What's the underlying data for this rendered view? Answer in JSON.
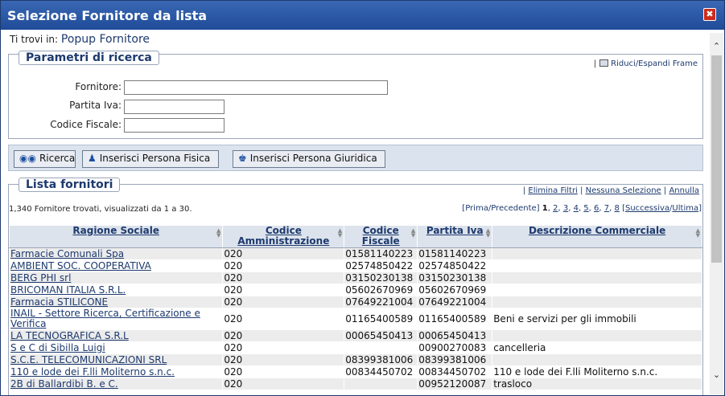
{
  "window": {
    "title": "Selezione Fornitore da lista",
    "close_label": "✖"
  },
  "breadcrumb": {
    "label": "Ti trovi in:",
    "value": "Popup Fornitore"
  },
  "search_panel": {
    "legend": "Parametri di ricerca",
    "frame_toggle": "Riduci/Espandi Frame",
    "fields": {
      "fornitore_label": "Fornitore:",
      "fornitore_value": "",
      "piva_label": "Partita Iva:",
      "piva_value": "",
      "cf_label": "Codice Fiscale:",
      "cf_value": ""
    }
  },
  "toolbar": {
    "search": "Ricerca",
    "add_physical": "Inserisci Persona Fisica",
    "add_legal": "Inserisci Persona Giuridica"
  },
  "list": {
    "legend": "Lista fornitori",
    "links": {
      "remove_filters": "Elimina Filtri",
      "no_selection": "Nessuna Selezione",
      "cancel": "Annulla"
    },
    "count_text": "1,340 Fornitore trovati, visualizzati da 1 a 30.",
    "pager": {
      "prefix": "[",
      "first": "Prima",
      "prev": "Precedente",
      "middle": "]",
      "current": "1",
      "pages": [
        "2",
        "3",
        "4",
        "5",
        "6",
        "7",
        "8"
      ],
      "next_prefix": "[",
      "next": "Successiva",
      "last": "Ultima",
      "suffix": "]"
    },
    "columns": {
      "name": "Ragione Sociale",
      "admin_code": "Codice Amministrazione",
      "fiscal_code": "Codice Fiscale",
      "vat": "Partita Iva",
      "description": "Descrizione Commerciale"
    },
    "rows": [
      {
        "name": "Farmacie Comunali Spa",
        "admin": "020",
        "cf": "01581140223",
        "vat": "01581140223",
        "desc": ""
      },
      {
        "name": "AMBIENT SOC. COOPERATIVA",
        "admin": "020",
        "cf": "02574850422",
        "vat": "02574850422",
        "desc": ""
      },
      {
        "name": "BERG PHI srl",
        "admin": "020",
        "cf": "03150230138",
        "vat": "03150230138",
        "desc": ""
      },
      {
        "name": "BRICOMAN ITALIA S.R.L.",
        "admin": "020",
        "cf": "05602670969",
        "vat": "05602670969",
        "desc": ""
      },
      {
        "name": "Farmacia STILICONE",
        "admin": "020",
        "cf": "07649221004",
        "vat": "07649221004",
        "desc": ""
      },
      {
        "name": "INAIL - Settore Ricerca, Certificazione e Verifica",
        "admin": "020",
        "cf": "01165400589",
        "vat": "01165400589",
        "desc": "Beni e servizi per gli immobili"
      },
      {
        "name": "LA TECNOGRAFICA S.R.L",
        "admin": "020",
        "cf": "00065450413",
        "vat": "00065450413",
        "desc": ""
      },
      {
        "name": "S e C di Sibilla Luigi",
        "admin": "020",
        "cf": "",
        "vat": "00900270083",
        "desc": "cancelleria"
      },
      {
        "name": "S.C.E. TELECOMUNICAZIONI SRL",
        "admin": "020",
        "cf": "08399381006",
        "vat": "08399381006",
        "desc": ""
      },
      {
        "name": "110 e lode dei F.lli Moliterno s.n.c.",
        "admin": "020",
        "cf": "00834450702",
        "vat": "00834450702",
        "desc": "110 e lode dei F.lli Moliterno s.n.c."
      },
      {
        "name": "2B di Ballardibi B. e C.",
        "admin": "020",
        "cf": "",
        "vat": "00952120087",
        "desc": "trasloco"
      }
    ]
  }
}
